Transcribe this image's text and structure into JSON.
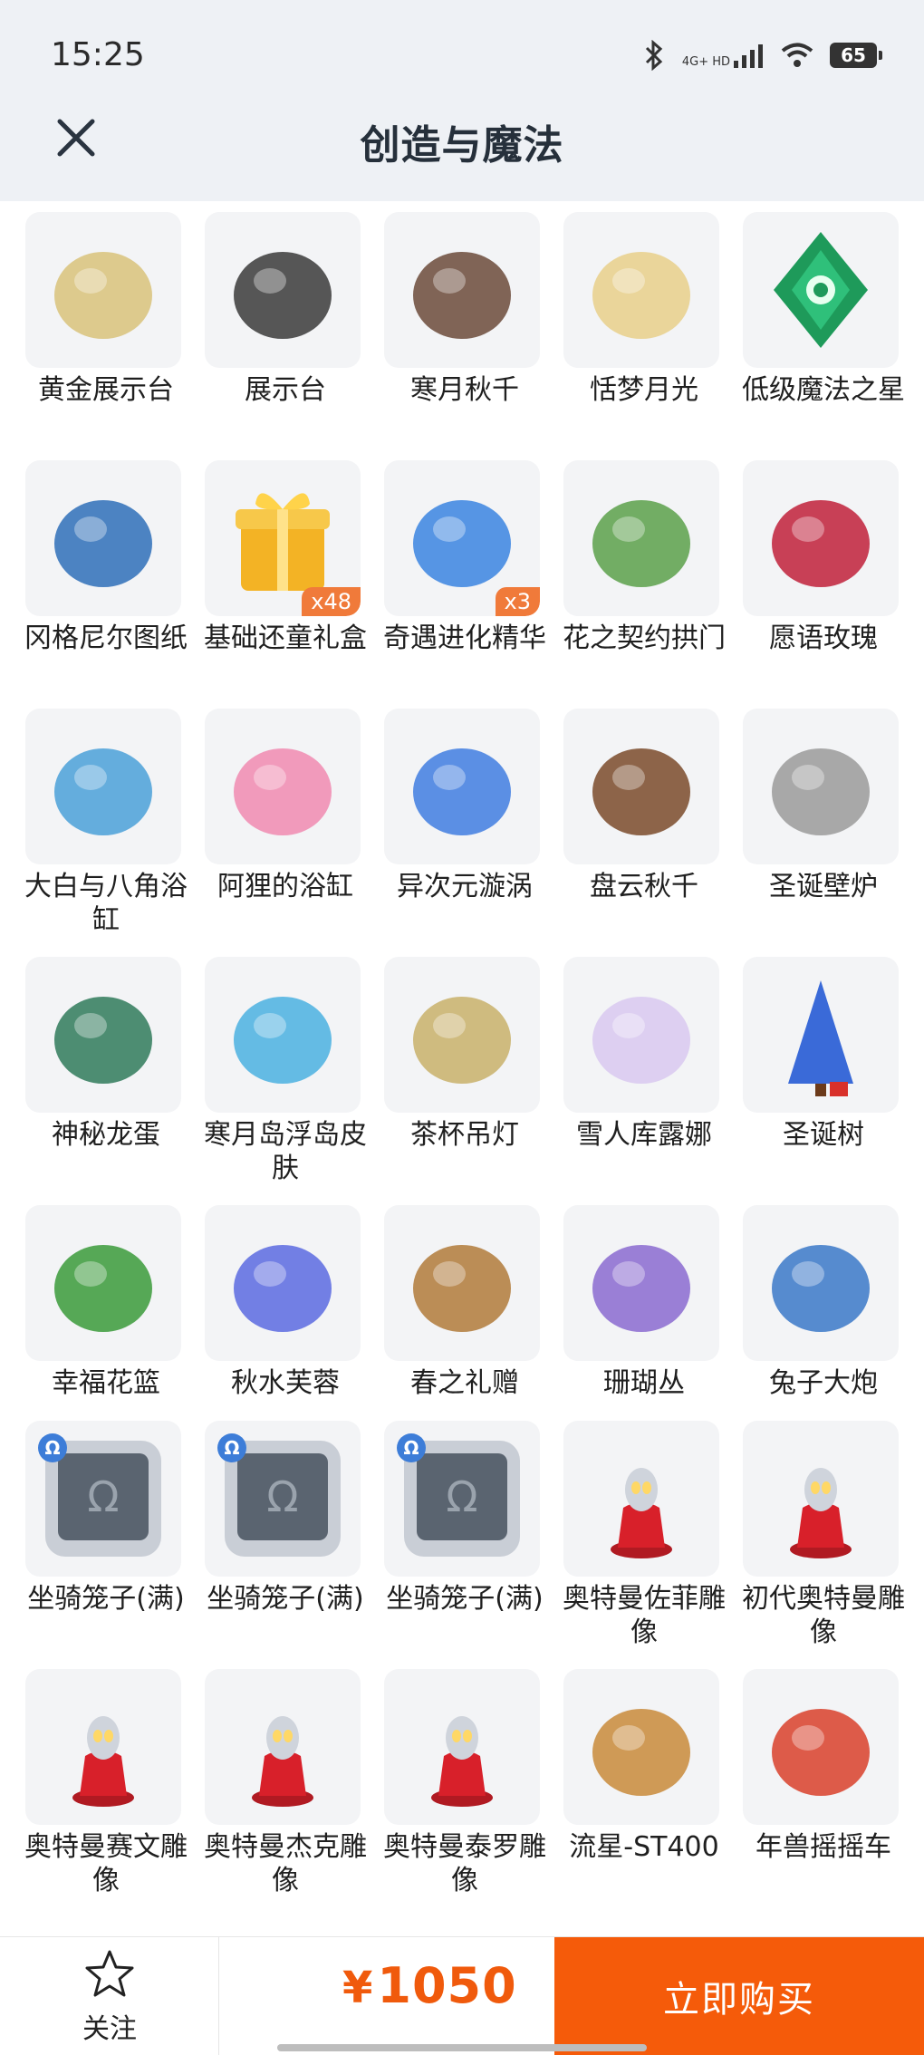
{
  "status": {
    "time": "15:25",
    "network": "4G+ HD",
    "battery": "65"
  },
  "header": {
    "title": "创造与魔法"
  },
  "items": [
    {
      "name": "黄金展示台",
      "icon": "golden-display-stand",
      "color": "#d8c27a",
      "badge": "",
      "lock": false
    },
    {
      "name": "展示台",
      "icon": "display-stand",
      "color": "#3a3a3a",
      "badge": "",
      "lock": false
    },
    {
      "name": "寒月秋千",
      "icon": "cold-moon-swing",
      "color": "#6b4a3a",
      "badge": "",
      "lock": false
    },
    {
      "name": "恬梦月光",
      "icon": "dream-moonlight",
      "color": "#e8cf8a",
      "badge": "",
      "lock": false
    },
    {
      "name": "低级魔法之星",
      "icon": "magic-star-gem",
      "color": "#1e9a5a",
      "badge": "",
      "lock": false
    },
    {
      "name": "冈格尼尔图纸",
      "icon": "gungnir-blueprint",
      "color": "#2e6fb8",
      "badge": "",
      "lock": false
    },
    {
      "name": "基础还童礼盒",
      "icon": "gift-box",
      "color": "#f3b325",
      "badge": "x48",
      "lock": false
    },
    {
      "name": "奇遇进化精华",
      "icon": "evolution-essence",
      "color": "#3a84e0",
      "badge": "x3",
      "lock": false
    },
    {
      "name": "花之契约拱门",
      "icon": "flower-arch",
      "color": "#5aa04a",
      "badge": "",
      "lock": false
    },
    {
      "name": "愿语玫瑰",
      "icon": "wish-rose",
      "color": "#c0203a",
      "badge": "",
      "lock": false
    },
    {
      "name": "大白与八角浴缸",
      "icon": "whale-bathtub",
      "color": "#4aa0d8",
      "badge": "",
      "lock": false
    },
    {
      "name": "阿狸的浴缸",
      "icon": "ali-bathtub",
      "color": "#f08ab0",
      "badge": "",
      "lock": false
    },
    {
      "name": "异次元漩涡",
      "icon": "dimension-vortex",
      "color": "#3f7de0",
      "badge": "",
      "lock": false
    },
    {
      "name": "盘云秋千",
      "icon": "cloud-swing",
      "color": "#7a4a2a",
      "badge": "",
      "lock": false
    },
    {
      "name": "圣诞壁炉",
      "icon": "christmas-fireplace",
      "color": "#9a9a9a",
      "badge": "",
      "lock": false
    },
    {
      "name": "神秘龙蛋",
      "icon": "dragon-egg",
      "color": "#2f7a5a",
      "badge": "",
      "lock": false
    },
    {
      "name": "寒月岛浮岛皮肤",
      "icon": "floating-island",
      "color": "#4ab0e0",
      "badge": "",
      "lock": false
    },
    {
      "name": "茶杯吊灯",
      "icon": "teacup-lamp",
      "color": "#c8b06a",
      "badge": "",
      "lock": false
    },
    {
      "name": "雪人库露娜",
      "icon": "snowman-kuluna",
      "color": "#d8c8f0",
      "badge": "",
      "lock": false
    },
    {
      "name": "圣诞树",
      "icon": "christmas-tree",
      "color": "#3a6ad8",
      "badge": "",
      "lock": false
    },
    {
      "name": "幸福花篮",
      "icon": "flower-basket-tower",
      "color": "#3a9a3a",
      "badge": "",
      "lock": false
    },
    {
      "name": "秋水芙蓉",
      "icon": "lotus",
      "color": "#5a6ae0",
      "badge": "",
      "lock": false
    },
    {
      "name": "春之礼赠",
      "icon": "spring-basket",
      "color": "#b07a3a",
      "badge": "",
      "lock": false
    },
    {
      "name": "珊瑚丛",
      "icon": "coral",
      "color": "#8a6ad0",
      "badge": "",
      "lock": false
    },
    {
      "name": "兔子大炮",
      "icon": "rabbit-cannon",
      "color": "#3a78c8",
      "badge": "",
      "lock": false
    },
    {
      "name": "坐骑笼子(满)",
      "icon": "mount-cage",
      "color": "#5a6470",
      "badge": "",
      "lock": true
    },
    {
      "name": "坐骑笼子(满)",
      "icon": "mount-cage",
      "color": "#5a6470",
      "badge": "",
      "lock": true
    },
    {
      "name": "坐骑笼子(满)",
      "icon": "mount-cage",
      "color": "#5a6470",
      "badge": "",
      "lock": true
    },
    {
      "name": "奥特曼佐菲雕像",
      "icon": "ultraman-statue",
      "color": "#d8202a",
      "badge": "",
      "lock": false
    },
    {
      "name": "初代奥特曼雕像",
      "icon": "ultraman-statue",
      "color": "#d8202a",
      "badge": "",
      "lock": false
    },
    {
      "name": "奥特曼赛文雕像",
      "icon": "ultraman-statue",
      "color": "#d8202a",
      "badge": "",
      "lock": false
    },
    {
      "name": "奥特曼杰克雕像",
      "icon": "ultraman-statue",
      "color": "#d8202a",
      "badge": "",
      "lock": false
    },
    {
      "name": "奥特曼泰罗雕像",
      "icon": "ultraman-statue",
      "color": "#d8202a",
      "badge": "",
      "lock": false
    },
    {
      "name": "流星-ST400",
      "icon": "meteor-vehicle",
      "color": "#c88a3a",
      "badge": "",
      "lock": false
    },
    {
      "name": "年兽摇摇车",
      "icon": "nian-rocking-car",
      "color": "#d8402a",
      "badge": "",
      "lock": false
    }
  ],
  "bottom": {
    "fav_label": "关注",
    "currency": "¥",
    "price": "1050",
    "buy_label": "立即购买",
    "accent": "#f55b0a"
  }
}
